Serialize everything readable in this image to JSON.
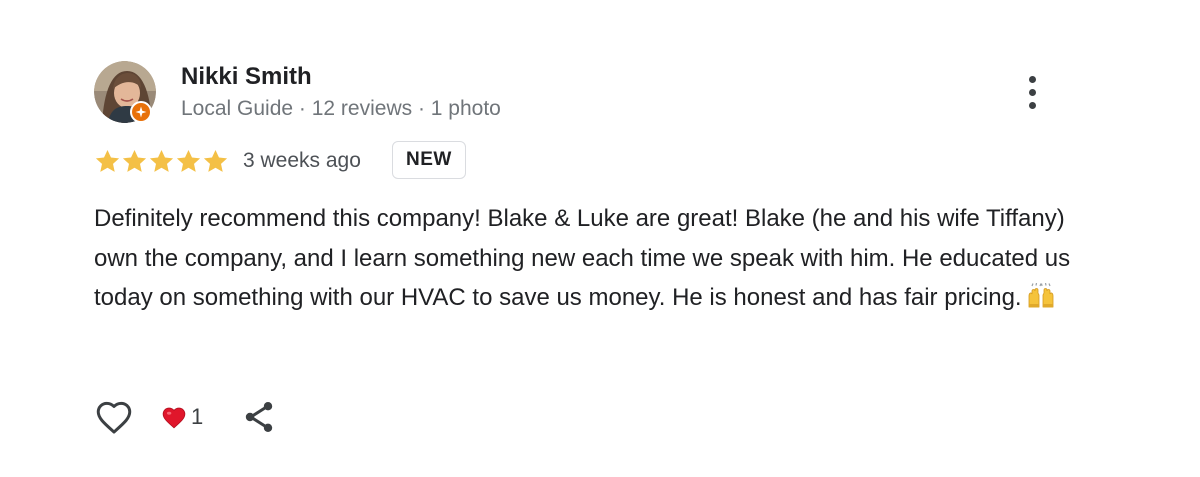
{
  "review": {
    "reviewer": {
      "name": "Nikki Smith",
      "meta": "Local Guide · 12 reviews · 1 photo",
      "badge_color": "#e8710a"
    },
    "rating": {
      "stars": 5,
      "max_stars": 5,
      "star_color": "#f4c046"
    },
    "date": "3 weeks ago",
    "new_badge": "NEW",
    "text": "Definitely recommend this company! Blake & Luke are great! Blake (he and his wife Tiffany) own the company, and I learn something new each time we speak with him. He educated us today on something with our HVAC to save us money. He is honest and has fair pricing.",
    "text_emoji": "raising-hands-icon",
    "actions": {
      "like_icon": "heart-outline-icon",
      "reaction_icon": "red-heart-icon",
      "reaction_count": "1",
      "share_icon": "share-icon",
      "more_icon": "more-vertical-icon"
    }
  }
}
